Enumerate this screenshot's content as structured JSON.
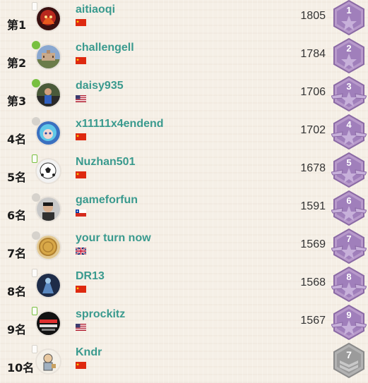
{
  "leaderboard": {
    "rows": [
      {
        "rank": "第1",
        "username": "aitiaoqi",
        "flag": "cn-flag",
        "status": "mobile-offline",
        "score": "1805",
        "badge_number": "1",
        "badge_type": "purple-star-hexagon",
        "avatar": "red-fire-avatar"
      },
      {
        "rank": "第2",
        "username": "challengell",
        "flag": "cn-flag",
        "status": "online",
        "score": "1784",
        "badge_number": "2",
        "badge_type": "purple-star-hexagon",
        "avatar": "castle-avatar"
      },
      {
        "rank": "第3",
        "username": "daisy935",
        "flag": "us-flag",
        "status": "online",
        "score": "1706",
        "badge_number": "3",
        "badge_type": "purple-winged-star-hexagon",
        "avatar": "person-avatar"
      },
      {
        "rank": "4名",
        "username": "x11111x4endend",
        "flag": "cn-flag",
        "status": "offline",
        "score": "1702",
        "badge_number": "4",
        "badge_type": "purple-winged-star-hexagon",
        "avatar": "anime-girl-avatar"
      },
      {
        "rank": "5名",
        "username": "Nuzhan501",
        "flag": "cn-flag",
        "status": "mobile-online",
        "score": "1678",
        "badge_number": "5",
        "badge_type": "purple-winged-star-hexagon",
        "avatar": "soccer-ball-avatar"
      },
      {
        "rank": "6名",
        "username": "gameforfun",
        "flag": "cl-flag",
        "status": "offline",
        "score": "1591",
        "badge_number": "6",
        "badge_type": "purple-winged-star-hexagon",
        "avatar": "face-avatar"
      },
      {
        "rank": "7名",
        "username": "your turn now",
        "flag": "gb-flag",
        "status": "offline",
        "score": "1569",
        "badge_number": "7",
        "badge_type": "purple-winged-star-hexagon",
        "avatar": "coin-avatar"
      },
      {
        "rank": "8名",
        "username": "DR13",
        "flag": "cn-flag",
        "status": "mobile-offline",
        "score": "1568",
        "badge_number": "8",
        "badge_type": "purple-winged-star-hexagon",
        "avatar": "dark-figure-avatar"
      },
      {
        "rank": "9名",
        "username": "sprockitz",
        "flag": "us-flag",
        "status": "mobile-online",
        "score": "1567",
        "badge_number": "9",
        "badge_type": "purple-winged-star-hexagon",
        "avatar": "hot-leagues-avatar"
      },
      {
        "rank": "10名",
        "username": "Kndr",
        "flag": "cn-flag",
        "status": "mobile-offline",
        "score": "",
        "badge_number": "7",
        "badge_type": "grey-chevron-hexagon",
        "avatar": "cartoon-avatar"
      }
    ]
  },
  "colors": {
    "username": "#3a9a8e",
    "online": "#78c040",
    "badge_purple": "#9a72b4",
    "badge_grey": "#9b9b9b"
  }
}
